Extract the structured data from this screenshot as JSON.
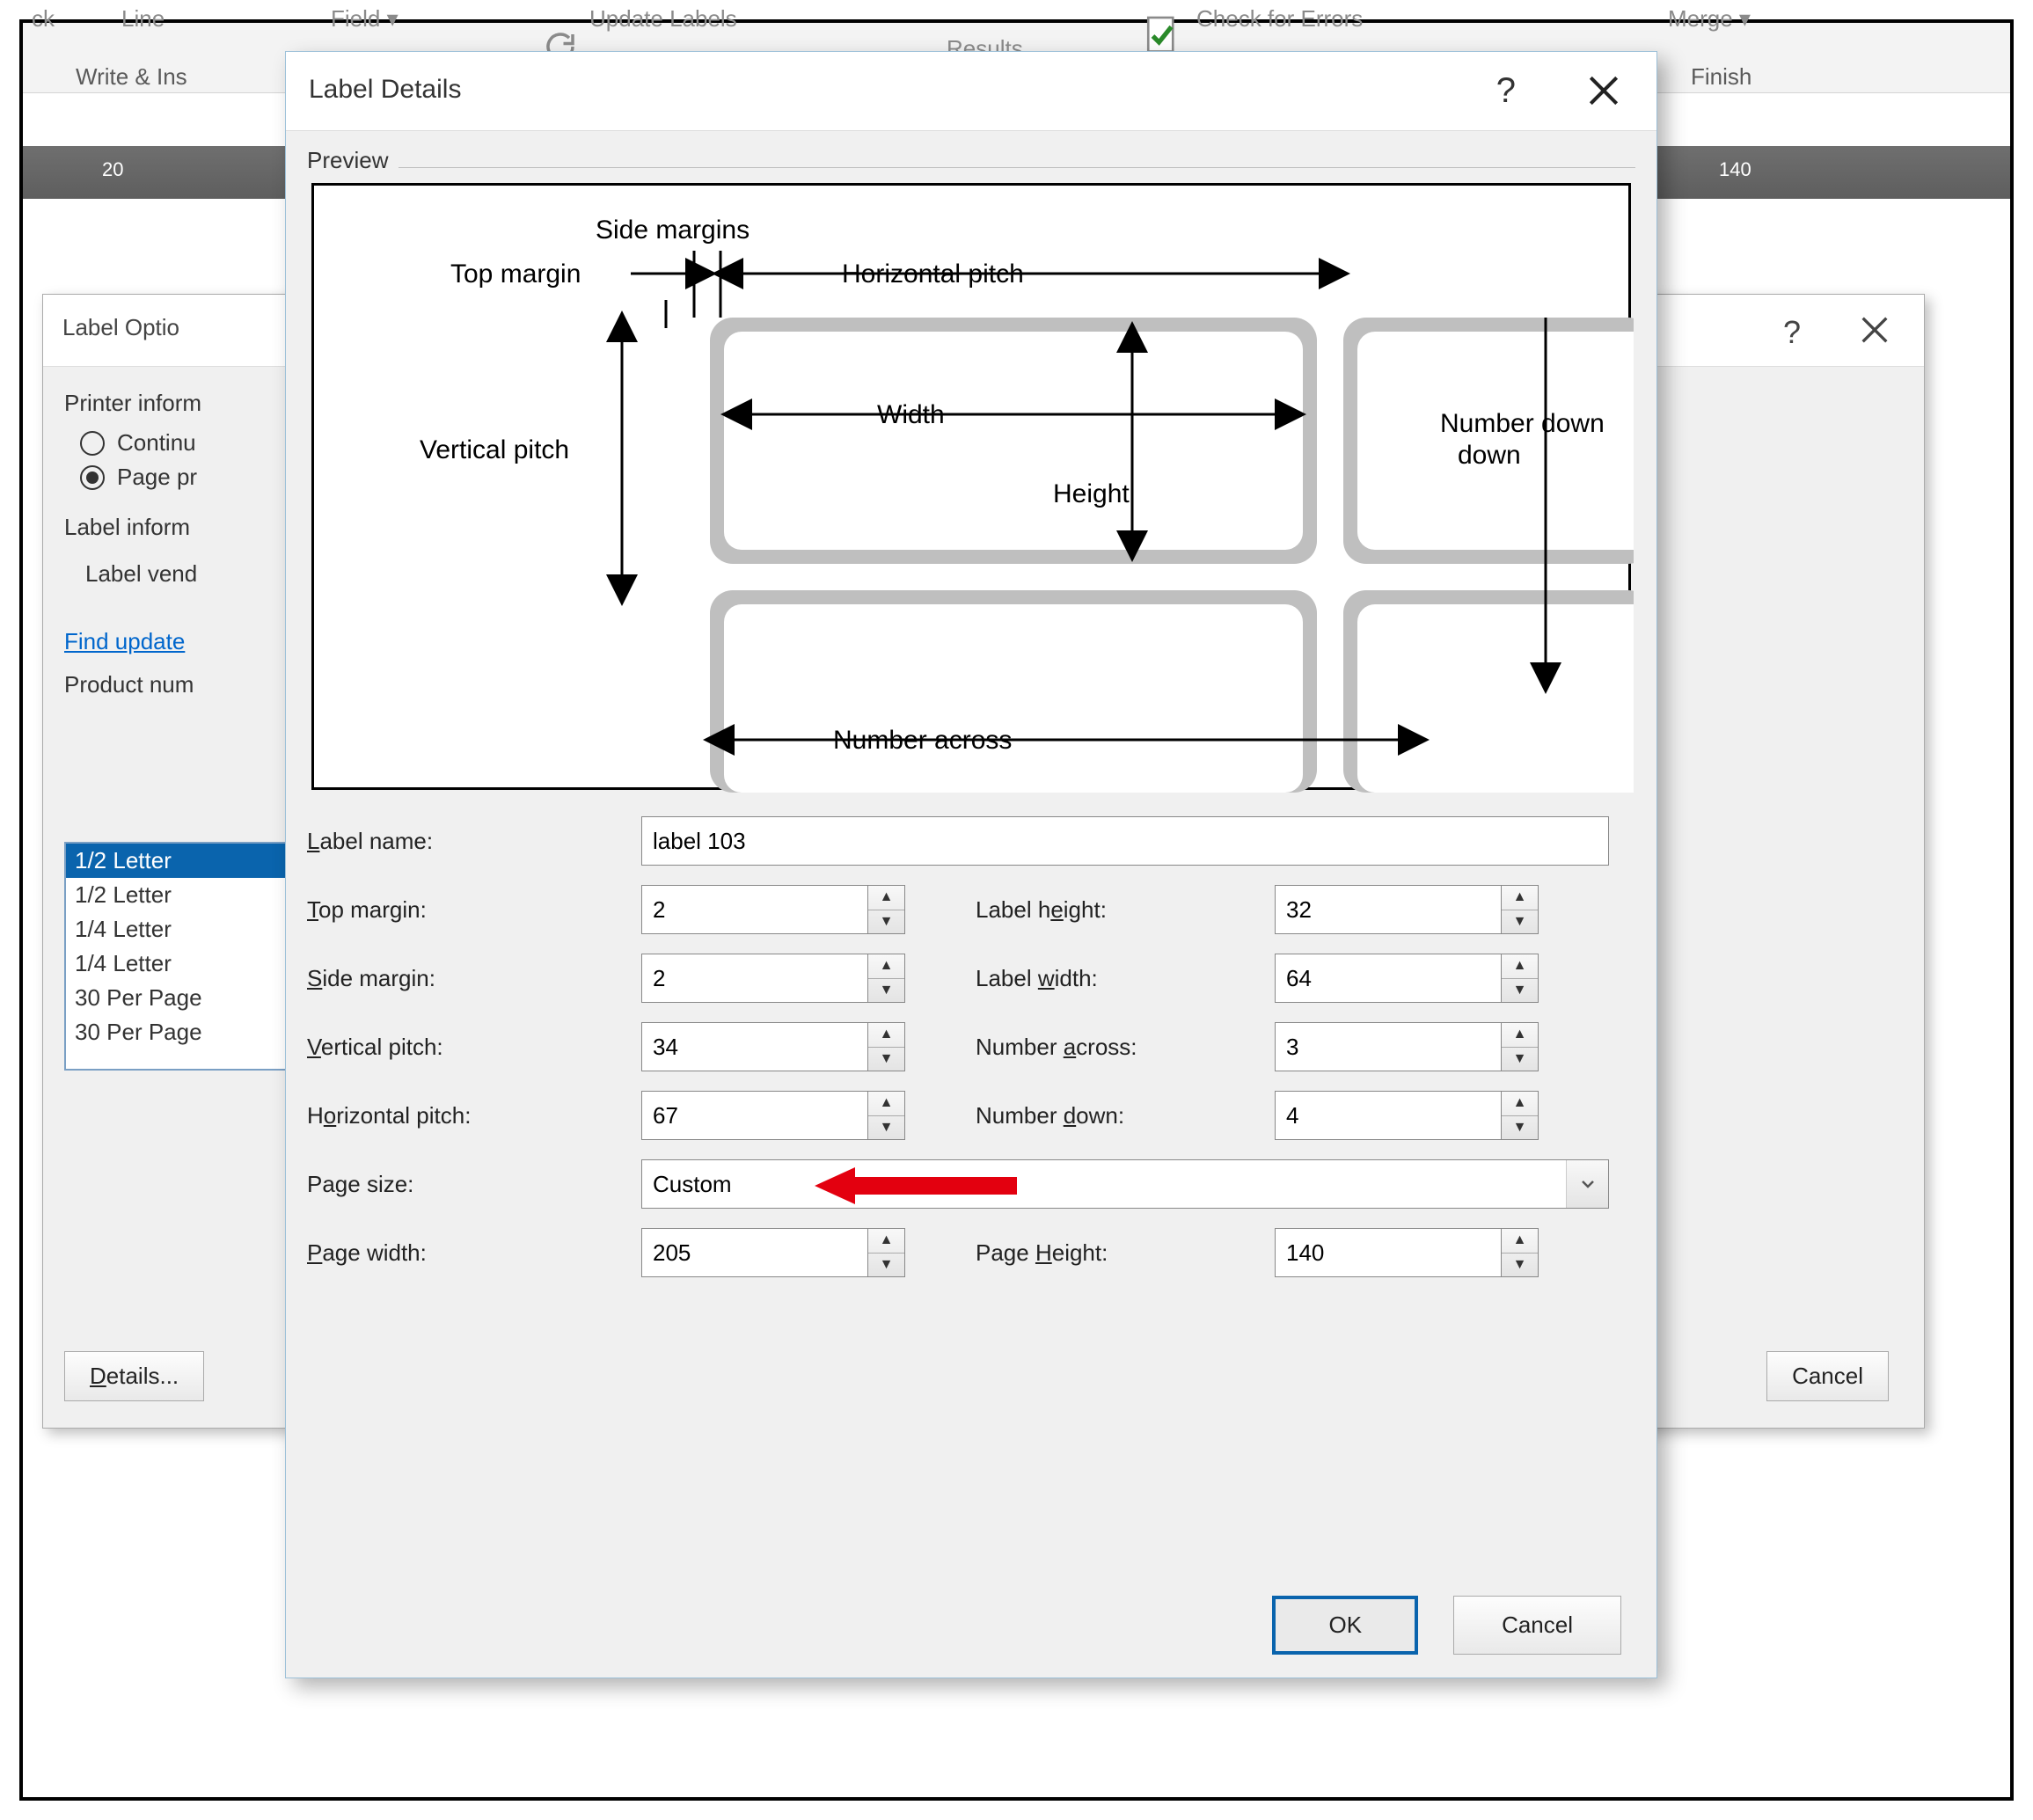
{
  "ribbon": {
    "ck": "ck",
    "line": "Line",
    "field": "Field ▾",
    "update_labels": "Update Labels",
    "results": "Results",
    "check_errors": "Check for Errors",
    "merge": "Merge ▾",
    "group_write": "Write & Ins",
    "group_finish": "Finish"
  },
  "ruler": {
    "t20": "20",
    "t140": "140"
  },
  "options_dialog": {
    "title": "Label Optio",
    "help": "?",
    "printer_info": "Printer inform",
    "radio_continuous": "Continu",
    "radio_page": "Page pr",
    "label_info": "Label inform",
    "label_vendor": "Label vend",
    "find_updates": "Find update",
    "product_number": "Product num",
    "products": [
      "1/2 Letter",
      "1/2 Letter",
      "1/4 Letter",
      "1/4 Letter",
      "30 Per Page",
      "30 Per Page"
    ],
    "btn_details": "Details...",
    "btn_cancel": "Cancel"
  },
  "details_dialog": {
    "title": "Label Details",
    "help": "?",
    "preview_label": "Preview",
    "diagram": {
      "side_margins": "Side margins",
      "top_margin": "Top margin",
      "horizontal_pitch": "Horizontal pitch",
      "vertical_pitch": "Vertical pitch",
      "width": "Width",
      "height": "Height",
      "number_down": "Number down",
      "number_across": "Number across"
    },
    "fields": {
      "label_name": {
        "label": "Label name:",
        "value": "label 103"
      },
      "top_margin": {
        "label": "Top margin:",
        "value": "2"
      },
      "side_margin": {
        "label": "Side margin:",
        "value": "2"
      },
      "vertical_pitch": {
        "label": "Vertical pitch:",
        "value": "34"
      },
      "horizontal_pitch": {
        "label": "Horizontal pitch:",
        "value": "67"
      },
      "label_height": {
        "label": "Label height:",
        "value": "32"
      },
      "label_width": {
        "label": "Label width:",
        "value": "64"
      },
      "number_across": {
        "label": "Number across:",
        "value": "3"
      },
      "number_down": {
        "label": "Number down:",
        "value": "4"
      },
      "page_size": {
        "label": "Page size:",
        "value": "Custom"
      },
      "page_width": {
        "label": "Page width:",
        "value": "205"
      },
      "page_height": {
        "label": "Page Height:",
        "value": "140"
      }
    },
    "btn_ok": "OK",
    "btn_cancel": "Cancel"
  }
}
